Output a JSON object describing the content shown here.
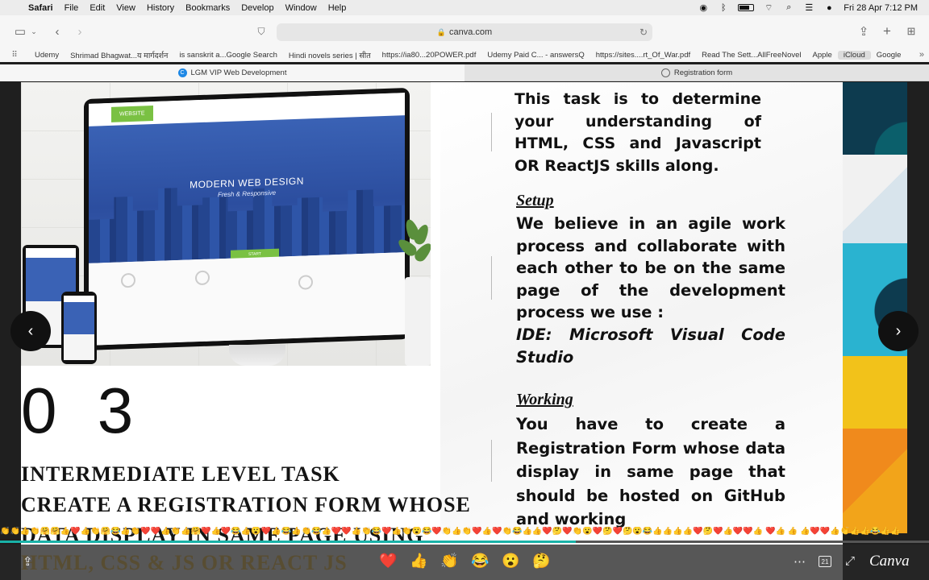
{
  "menubar": {
    "app": "Safari",
    "items": [
      "File",
      "Edit",
      "View",
      "History",
      "Bookmarks",
      "Develop",
      "Window",
      "Help"
    ],
    "clock": "Fri 28 Apr  7:12 PM"
  },
  "toolbar": {
    "url": "canva.com"
  },
  "favorites": [
    "Udemy",
    "Shrimad Bhagwat...य मार्गदर्शन",
    "is sanskrit a...Google Search",
    "Hindi novels series | सीत",
    "https://ia80...20POWER.pdf",
    "Udemy Paid C... - answersQ",
    "https://sites....rt_Of_War.pdf",
    "Read The Sett...AllFreeNovel",
    "Apple",
    "iCloud",
    "Google"
  ],
  "tabs": [
    {
      "label": "LGM VIP Web Development",
      "icon": "C"
    },
    {
      "label": "Registration form"
    }
  ],
  "slide": {
    "photo": {
      "badge": "WEBSITE",
      "hero_title": "MODERN WEB DESIGN",
      "hero_sub": "Fresh & Responsive",
      "hero_btn": "START"
    },
    "number": "0 3",
    "heading_lines": [
      "INTERMEDIATE LEVEL TASK",
      "CREATE A REGISTRATION FORM WHOSE",
      "DATA DISPLAY IN SAME PAGE USING",
      "HTML, CSS & JS OR REACT JS"
    ],
    "intro": "This task is to determine your understanding of HTML, CSS and Javascript OR ReactJS skills along.",
    "setup_title": "Setup",
    "setup_text": "We believe in an agile work process and collaborate with each other to be on the same page of the development process we use :",
    "ide_text": "IDE: Microsoft Visual Code Studio",
    "working_title": "Working",
    "working_text": "You have to create a Registration Form whose data display in same page that should be hosted on GitHub and working"
  },
  "emoji_strip": "👏👏👍👏🤗🤗👍❤️👍👏🤗😂👍👏❤️❤️👍👏👍🤗❤️👍❤️😂👍😮❤️👍😂👍👏😂👍❤️❤️👍👏😂❤️👍👏😮😂❤️👏👍👏❤️👍❤️👏😂👍👍❤️🤔❤️👏😮❤️🤔❤️🤔😮😂👍👍👍👍❤️🤔❤️👍❤️❤️👍      ❤️👍            👍      👍❤️❤️👍👏👍👍😂👍👍",
  "progress": 0.62,
  "reactions": [
    "❤️",
    "👍",
    "👏",
    "😂",
    "😮",
    "🤔"
  ],
  "bottom": {
    "page_count": "21",
    "brand": "Canva"
  }
}
